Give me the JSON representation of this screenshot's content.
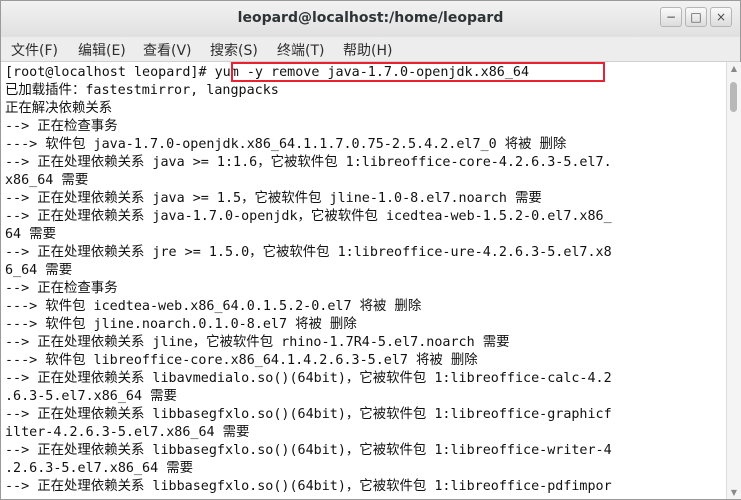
{
  "window": {
    "title": "leopard@localhost:/home/leopard",
    "buttons": {
      "minimize": "−",
      "maximize": "□",
      "close": "×"
    }
  },
  "menubar": {
    "items": [
      "文件(F)",
      "编辑(E)",
      "查看(V)",
      "搜索(S)",
      "终端(T)",
      "帮助(H)"
    ]
  },
  "terminal": {
    "prompt": "[root@localhost leopard]# ",
    "command": "yum -y remove java-1.7.0-openjdk.x86_64",
    "lines": [
      "已加载插件：fastestmirror, langpacks",
      "正在解决依赖关系",
      "--> 正在检查事务",
      "---> 软件包 java-1.7.0-openjdk.x86_64.1.1.7.0.75-2.5.4.2.el7_0 将被 删除",
      "--> 正在处理依赖关系 java >= 1:1.6，它被软件包 1:libreoffice-core-4.2.6.3-5.el7.",
      "x86_64 需要",
      "--> 正在处理依赖关系 java >= 1.5，它被软件包 jline-1.0-8.el7.noarch 需要",
      "--> 正在处理依赖关系 java-1.7.0-openjdk，它被软件包 icedtea-web-1.5.2-0.el7.x86_",
      "64 需要",
      "--> 正在处理依赖关系 jre >= 1.5.0，它被软件包 1:libreoffice-ure-4.2.6.3-5.el7.x8",
      "6_64 需要",
      "--> 正在检查事务",
      "---> 软件包 icedtea-web.x86_64.0.1.5.2-0.el7 将被 删除",
      "---> 软件包 jline.noarch.0.1.0-8.el7 将被 删除",
      "--> 正在处理依赖关系 jline，它被软件包 rhino-1.7R4-5.el7.noarch 需要",
      "---> 软件包 libreoffice-core.x86_64.1.4.2.6.3-5.el7 将被 删除",
      "--> 正在处理依赖关系 libavmedialo.so()(64bit)，它被软件包 1:libreoffice-calc-4.2",
      ".6.3-5.el7.x86_64 需要",
      "--> 正在处理依赖关系 libbasegfxlo.so()(64bit)，它被软件包 1:libreoffice-graphicf",
      "ilter-4.2.6.3-5.el7.x86_64 需要",
      "--> 正在处理依赖关系 libbasegfxlo.so()(64bit)，它被软件包 1:libreoffice-writer-4",
      ".2.6.3-5.el7.x86_64 需要",
      "--> 正在处理依赖关系 libbasegfxlo.so()(64bit)，它被软件包 1:libreoffice-pdfimpor"
    ]
  },
  "colors": {
    "highlight": "#e8232f",
    "text": "#111111",
    "background": "#ffffff"
  }
}
